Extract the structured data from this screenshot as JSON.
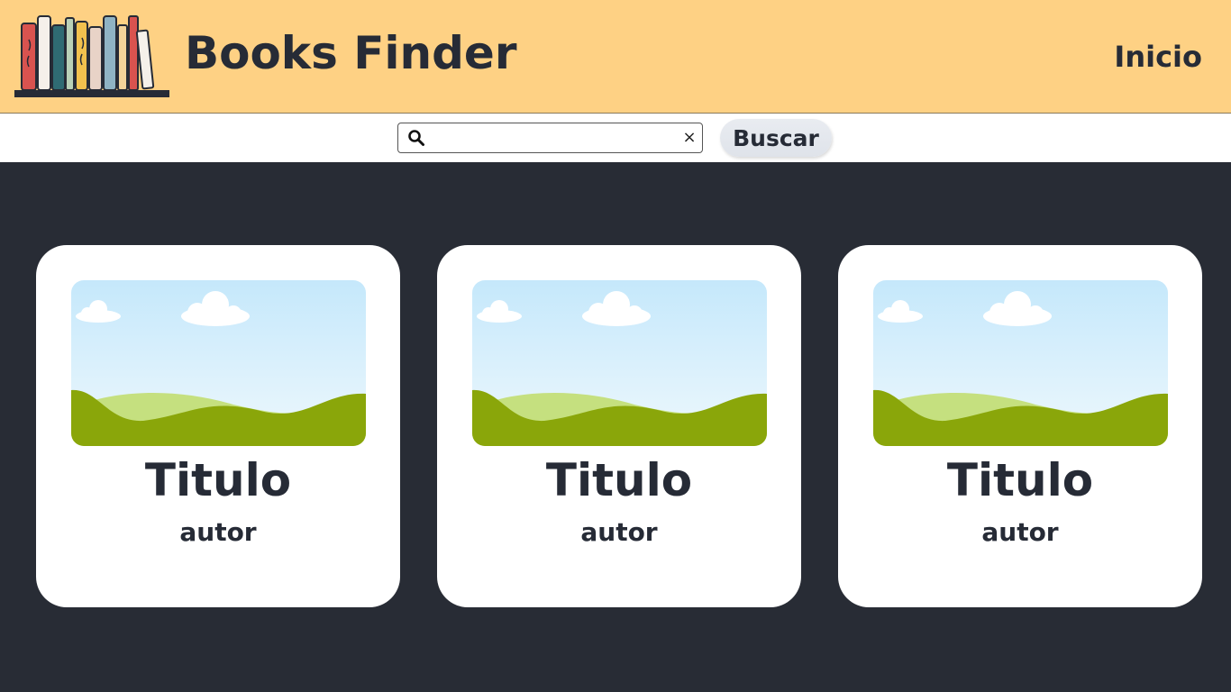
{
  "header": {
    "app_title": "Books Finder",
    "nav_home": "Inicio",
    "logo_icon": "bookshelf-icon"
  },
  "search": {
    "value": "",
    "placeholder": "",
    "search_icon": "magnifier-icon",
    "clear_label": "×",
    "button_label": "Buscar"
  },
  "cards": [
    {
      "title": "Titulo",
      "author": "autor",
      "image_icon": "landscape-placeholder-icon"
    },
    {
      "title": "Titulo",
      "author": "autor",
      "image_icon": "landscape-placeholder-icon"
    },
    {
      "title": "Titulo",
      "author": "autor",
      "image_icon": "landscape-placeholder-icon"
    }
  ],
  "colors": {
    "header_bg": "#fed184",
    "page_bg": "#282c35",
    "card_bg": "#ffffff",
    "text": "#262b36"
  }
}
